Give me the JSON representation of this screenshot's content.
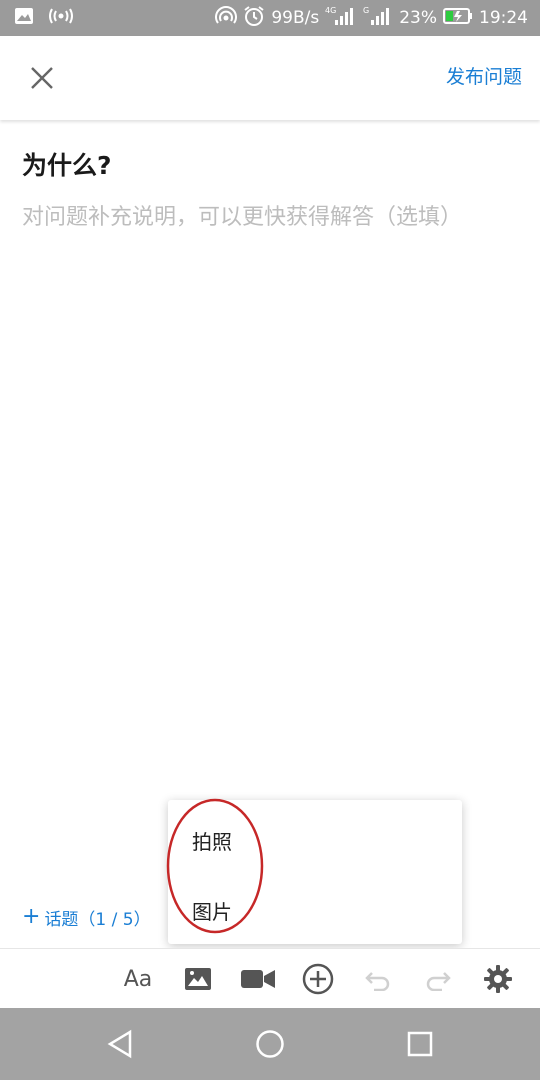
{
  "status_bar": {
    "network_speed": "99B/s",
    "signal_1_label": "4G",
    "signal_2_label": "G",
    "battery_percent": "23%",
    "time": "19:24"
  },
  "header": {
    "close_icon": "close-icon",
    "publish_label": "发布问题"
  },
  "editor": {
    "question_title": "为什么?",
    "description_placeholder": "对问题补充说明，可以更快获得解答（选填）"
  },
  "topic": {
    "plus": "+",
    "label": "话题（1 / 5）"
  },
  "popup_menu": {
    "items": [
      {
        "label": "拍照"
      },
      {
        "label": "图片"
      }
    ]
  },
  "toolbar": {
    "font_label": "Aa",
    "icons": [
      "text-format-icon",
      "image-icon",
      "video-icon",
      "add-circle-icon",
      "undo-icon",
      "redo-icon",
      "settings-icon"
    ]
  },
  "colors": {
    "accent": "#1a7ed4",
    "status_bar": "#9b9b9b",
    "nav_bar": "#a3a3a3",
    "annotation": "#c62828"
  }
}
